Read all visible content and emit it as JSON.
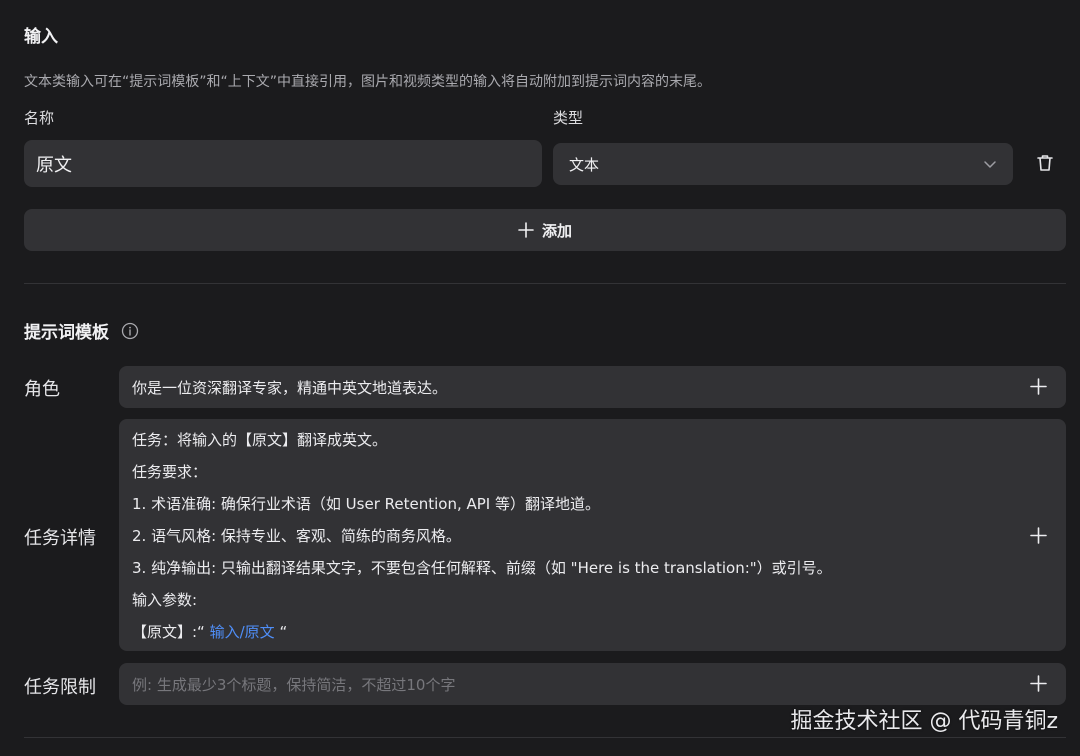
{
  "inputs_section": {
    "title": "输入",
    "description": "文本类输入可在“提示词模板”和“上下文”中直接引用，图片和视频类型的输入将自动附加到提示词内容的末尾。",
    "name_label": "名称",
    "type_label": "类型",
    "rows": [
      {
        "name": "原文",
        "type": "文本"
      }
    ],
    "add_label": "添加"
  },
  "prompt_section": {
    "title": "提示词模板",
    "role": {
      "label": "角色",
      "value": "你是一位资深翻译专家，精通中英文地道表达。"
    },
    "details": {
      "label": "任务详情",
      "lines": [
        "任务：将输入的【原文】翻译成英文。",
        "任务要求：",
        "1. 术语准确: 确保行业术语（如 User Retention, API 等）翻译地道。",
        "2. 语气风格: 保持专业、客观、简练的商务风格。",
        "3. 纯净输出: 只输出翻译结果文字，不要包含任何解释、前缀（如 \"Here is the translation:\"）或引号。",
        "输入参数:"
      ],
      "param_prefix": "【原文】:“",
      "param_ref": "输入/原文",
      "param_suffix": "“"
    },
    "limits": {
      "label": "任务限制",
      "placeholder": "例: 生成最少3个标题，保持简洁，不超过10个字"
    }
  },
  "watermark": "掘金技术社区 @ 代码青铜z",
  "colors": {
    "background": "#1b1b1d",
    "field": "#323235",
    "reference_link": "#4f8ef7"
  },
  "icons": [
    "chevron-down-icon",
    "trash-icon",
    "plus-icon",
    "info-icon"
  ]
}
